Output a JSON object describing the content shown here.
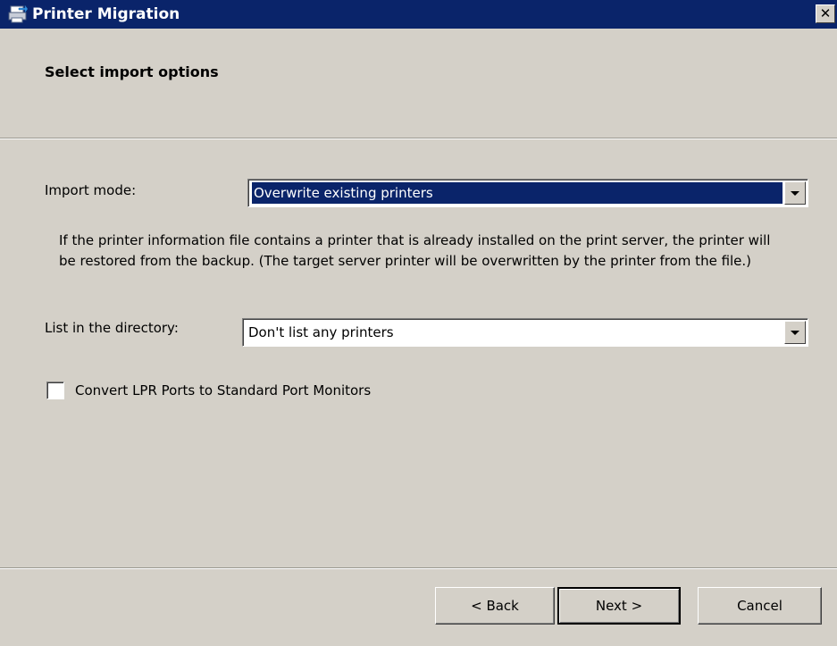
{
  "window": {
    "title": "Printer Migration",
    "close_glyph": "✕",
    "icon": "printer-migration-icon"
  },
  "header": {
    "title": "Select import options"
  },
  "import_mode": {
    "label": "Import mode:",
    "selected": "Overwrite existing printers"
  },
  "description": "If the printer information file contains a printer that is already installed on the print server, the printer will be restored from the backup.  (The target server printer will be overwritten by the printer from the file.)",
  "directory": {
    "label": "List in the directory:",
    "selected": "Don't list any printers"
  },
  "convert_lpr": {
    "label": "Convert LPR Ports to Standard Port Monitors",
    "checked": false
  },
  "buttons": {
    "back": "< Back",
    "next": "Next >",
    "cancel": "Cancel"
  },
  "colors": {
    "titlebar": "#0a246a",
    "face": "#d4d0c8",
    "selection": "#0a246a"
  }
}
